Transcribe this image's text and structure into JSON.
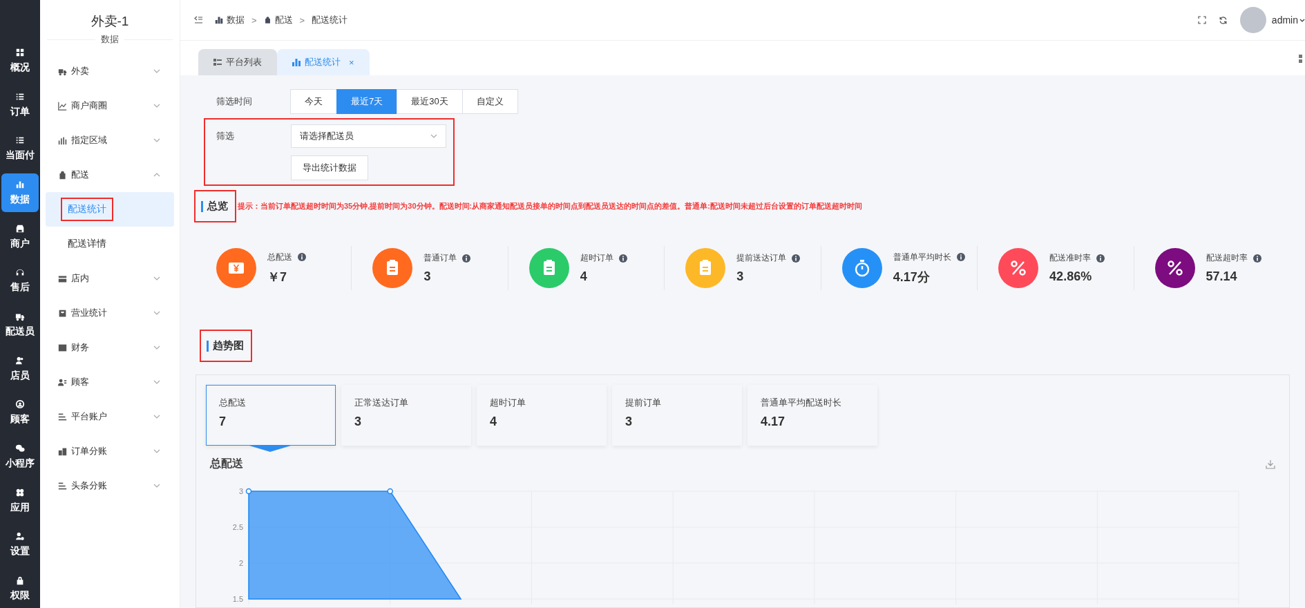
{
  "nav": [
    {
      "label": "概况",
      "selected": false
    },
    {
      "label": "订单",
      "selected": false
    },
    {
      "label": "当面付",
      "selected": false
    },
    {
      "label": "数据",
      "selected": true
    },
    {
      "label": "商户",
      "selected": false
    },
    {
      "label": "售后",
      "selected": false
    },
    {
      "label": "配送员",
      "selected": false
    },
    {
      "label": "店员",
      "selected": false
    },
    {
      "label": "顾客",
      "selected": false
    },
    {
      "label": "小程序",
      "selected": false
    },
    {
      "label": "应用",
      "selected": false
    },
    {
      "label": "设置",
      "selected": false
    },
    {
      "label": "权限",
      "selected": false
    }
  ],
  "submenu": {
    "title": "外卖-1",
    "subtitle": "数据",
    "items": [
      {
        "label": "外卖",
        "expanded": false
      },
      {
        "label": "商户商圈",
        "expanded": false
      },
      {
        "label": "指定区域",
        "expanded": false
      },
      {
        "label": "配送",
        "expanded": true,
        "children": [
          {
            "label": "配送统计",
            "selected": true,
            "highlighted": true
          },
          {
            "label": "配送详情",
            "selected": false,
            "highlighted": false
          }
        ]
      },
      {
        "label": "店内",
        "expanded": false
      },
      {
        "label": "营业统计",
        "expanded": false
      },
      {
        "label": "财务",
        "expanded": false
      },
      {
        "label": "顾客",
        "expanded": false
      },
      {
        "label": "平台账户",
        "expanded": false
      },
      {
        "label": "订单分账",
        "expanded": false
      },
      {
        "label": "头条分账",
        "expanded": false
      }
    ]
  },
  "breadcrumb": [
    {
      "kind": "crumb",
      "text": "数据"
    },
    {
      "kind": "separator",
      "text": ">"
    },
    {
      "kind": "crumb",
      "text": "配送"
    },
    {
      "kind": "separator",
      "text": ">"
    },
    {
      "kind": "crumb",
      "text": "配送统计"
    }
  ],
  "user": {
    "name": "admin"
  },
  "tabs": [
    {
      "label": "平台列表",
      "selected": false
    },
    {
      "label": "配送统计",
      "selected": true,
      "close": "×"
    }
  ],
  "filter": {
    "time_label": "筛选时间",
    "ranges": [
      {
        "label": "今天",
        "selected": false
      },
      {
        "label": "最近7天",
        "selected": true
      },
      {
        "label": "最近30天",
        "selected": false
      },
      {
        "label": "自定义",
        "selected": false
      }
    ],
    "courier_label": "筛选",
    "courier_placeholder": "请选择配送员",
    "export_button": "导出统计数据",
    "highlighted": true
  },
  "overview": {
    "title": "总览",
    "highlighted": true,
    "hint": "提示：当前订单配送超时时间为35分钟,提前时间为30分钟。配送时间:从商家通知配送员接单的时间点到配送员送达的时间点的差值。普通单:配送时间未超过后台设置的订单配送超时时间",
    "stats": [
      {
        "label": "总配送",
        "value": "￥7",
        "color": "#ff6a1f"
      },
      {
        "label": "普通订单",
        "value": "3",
        "color": "#ff6a1f"
      },
      {
        "label": "超时订单",
        "value": "4",
        "color": "#2bcb6a"
      },
      {
        "label": "提前送达订单",
        "value": "3",
        "color": "#fdb827"
      },
      {
        "label": "普通单平均时长",
        "value": "4.17分",
        "color": "#2591f7"
      },
      {
        "label": "配送准时率",
        "value": "42.86%",
        "color": "#ff4a5a"
      },
      {
        "label": "配送超时率",
        "value": "57.14",
        "color": "#7c0c7f"
      }
    ]
  },
  "trend": {
    "title": "趋势图",
    "highlighted": true,
    "cards": [
      {
        "label": "总配送",
        "value": "7",
        "selected": true
      },
      {
        "label": "正常送达订单",
        "value": "3",
        "selected": false
      },
      {
        "label": "超时订单",
        "value": "4",
        "selected": false
      },
      {
        "label": "提前订单",
        "value": "3",
        "selected": false
      },
      {
        "label": "普通单平均配送时长",
        "value": "4.17",
        "selected": false
      }
    ],
    "chart": {
      "title": "总配送",
      "y_labels": [
        "3",
        "2.5",
        "2",
        "1.5"
      ]
    }
  }
}
